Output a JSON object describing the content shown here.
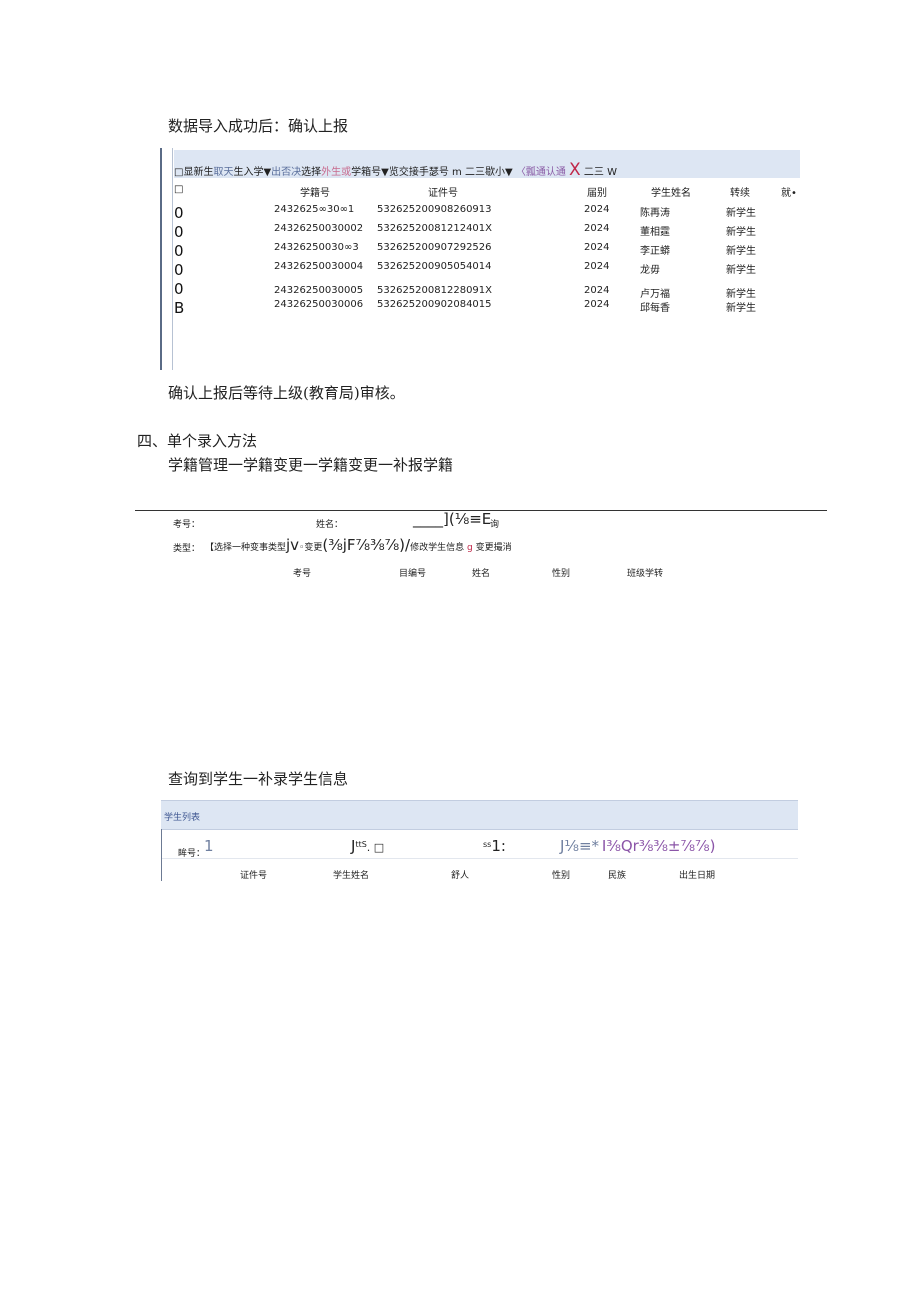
{
  "paragraphs": {
    "import_success": "数据导入成功后：确认上报",
    "after_report": "确认上报后等待上级(教育局)审核。",
    "section_four": "四、单个录入方法",
    "nav_path": "学籍管理一学籍变更一学籍变更一补报学籍",
    "query_then": "查询到学生一补录学生信息"
  },
  "panel1": {
    "toolbar": {
      "check": "□",
      "t1": "显新生",
      "t2": "取天",
      "t3": "生入学▼",
      "t4": "出否决",
      "t5": "选择",
      "t6": "外生或",
      "t7": "学箱号▼览交接手瑟号",
      "t8": "m 二三歇小▼",
      "t9": "〈瓢通认通",
      "x": "X",
      "t10": "二三 W"
    },
    "header": {
      "check": "□",
      "col_id": "学籍号",
      "col_cert": "证件号",
      "col_year": "届别",
      "col_name": "学生姓名",
      "col_type": "转续",
      "col_extra": "就•"
    },
    "rows": [
      {
        "mark": "0",
        "id": "2432625∞30∞1",
        "cert": "532625200908260913",
        "year": "2024",
        "name": "陈再涛",
        "type": "新学生"
      },
      {
        "mark": "0",
        "id": "24326250030002",
        "cert": "53262520081212401X",
        "year": "2024",
        "name": "董相霆",
        "type": "新学生"
      },
      {
        "mark": "0",
        "id": "24326250030∞3",
        "cert": "532625200907292526",
        "year": "2024",
        "name": "李正蟒",
        "type": "新学生"
      },
      {
        "mark": "0",
        "id": "24326250030004",
        "cert": "532625200905054014",
        "year": "2024",
        "name": "龙毋",
        "type": "新学生"
      },
      {
        "mark": "0",
        "id": "24326250030005",
        "cert": "53262520081228091X",
        "year": "2024",
        "name": "卢万福",
        "type": "新学生"
      },
      {
        "mark": "B",
        "id": "24326250030006",
        "cert": "532625200902084015",
        "year": "2024",
        "name": "邱每香",
        "type": "新学生"
      }
    ]
  },
  "panel2": {
    "exam_no_label": "考号：",
    "name_label": "姓名：",
    "garble1": "____](⅛≡E",
    "query": "询",
    "type_label": "类型：",
    "type_select": "【选择一种变事类型",
    "jv": "jv",
    "jv_suffix": "◦变更",
    "garble2": "(⅜jF⅞⅜⅞)",
    "slash": "/",
    "modify": "修改学生信息",
    "g": "g",
    "cancel": "变更撮消",
    "cols": {
      "exam": "考号",
      "self_no": "目编号",
      "name": "姓名",
      "gender": "性别",
      "class": "班级学转"
    }
  },
  "panel3": {
    "title": "学生列表",
    "label1": "眸号：",
    "val1": "1",
    "jtts": "J",
    "jtts_sup": "ttS",
    "jtts_tail": ". □",
    "ss": "ss",
    "ss_val": "1:",
    "garble_a": "J⅛≡*",
    "garble_b": "I⅜Qr⅜⅜±⅞⅞)",
    "cols": {
      "cert": "证件号",
      "name": "学生姓名",
      "person": "舒人",
      "gender": "性别",
      "ethnic": "民族",
      "birth": "出生日期"
    }
  }
}
